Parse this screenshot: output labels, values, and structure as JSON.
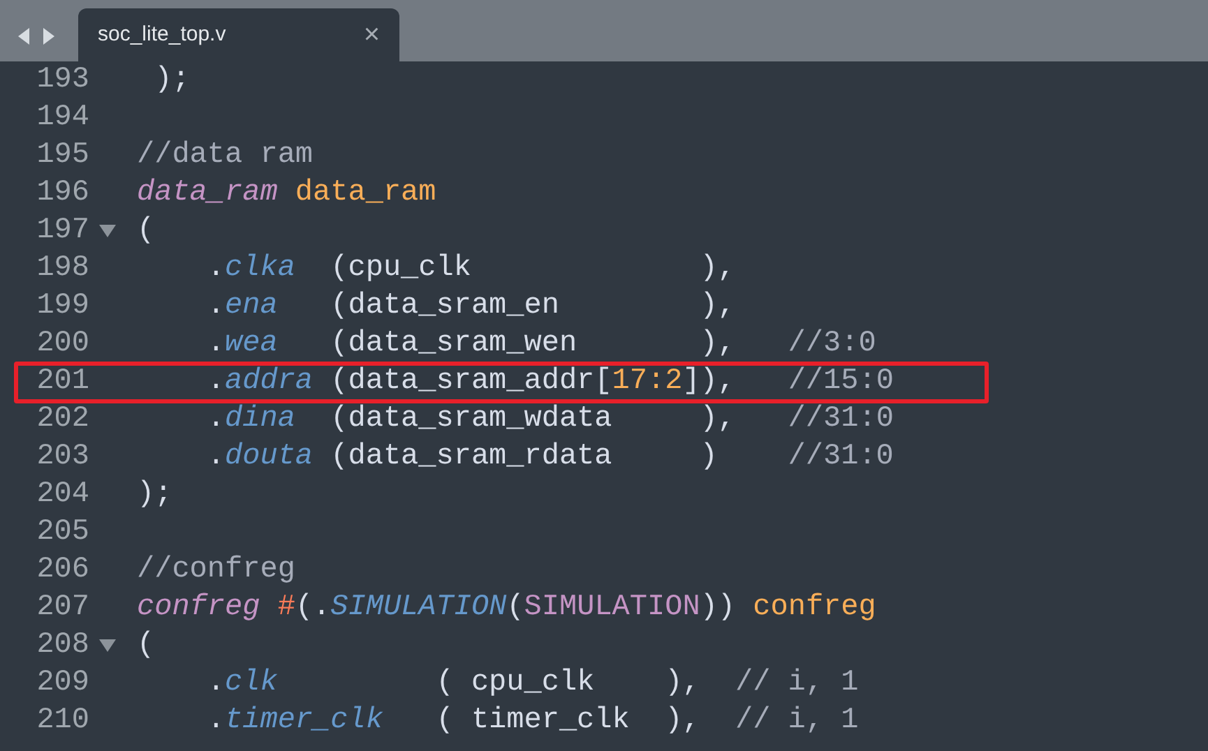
{
  "tab_bar": {
    "tabs": [
      {
        "label": "soc_lite_top.v",
        "close": "×",
        "selected": true
      }
    ]
  },
  "editor": {
    "lines": [
      {
        "number": "193",
        "foldable": false,
        "highlighted": false,
        "tokens": [
          {
            "kind": "plain",
            "text": " );"
          }
        ]
      },
      {
        "number": "194",
        "foldable": false,
        "highlighted": false
      },
      {
        "number": "195",
        "foldable": false,
        "highlighted": false,
        "tokens": [
          {
            "kind": "comment",
            "text": "//data ram"
          }
        ]
      },
      {
        "number": "196",
        "foldable": false,
        "highlighted": false,
        "tokens": [
          {
            "kind": "keyword",
            "text": "data_ram"
          },
          {
            "kind": "name",
            "text": " data_ram"
          }
        ]
      },
      {
        "number": "197",
        "foldable": true,
        "highlighted": false,
        "tokens": [
          {
            "kind": "plain",
            "text": "("
          }
        ]
      },
      {
        "number": "198",
        "foldable": false,
        "highlighted": false,
        "tokens": [
          {
            "kind": "plain",
            "text": "    ."
          },
          {
            "kind": "port",
            "text": "clka"
          },
          {
            "kind": "plain",
            "text": "  (cpu_clk             ),"
          }
        ]
      },
      {
        "number": "199",
        "foldable": false,
        "highlighted": false,
        "tokens": [
          {
            "kind": "plain",
            "text": "    ."
          },
          {
            "kind": "port",
            "text": "ena"
          },
          {
            "kind": "plain",
            "text": "   (data_sram_en        ),"
          }
        ]
      },
      {
        "number": "200",
        "foldable": false,
        "highlighted": false,
        "tokens": [
          {
            "kind": "plain",
            "text": "    ."
          },
          {
            "kind": "port",
            "text": "wea"
          },
          {
            "kind": "plain",
            "text": "   (data_sram_wen       ),"
          },
          {
            "kind": "comment",
            "text": "   //3:0"
          }
        ]
      },
      {
        "number": "201",
        "foldable": false,
        "highlighted": true,
        "tokens": [
          {
            "kind": "plain",
            "text": "    ."
          },
          {
            "kind": "port",
            "text": "addra"
          },
          {
            "kind": "plain",
            "text": " (data_sram_addr["
          },
          {
            "kind": "number",
            "text": "17:2"
          },
          {
            "kind": "plain",
            "text": "]),"
          },
          {
            "kind": "comment",
            "text": "   //15:0"
          }
        ]
      },
      {
        "number": "202",
        "foldable": false,
        "highlighted": false,
        "tokens": [
          {
            "kind": "plain",
            "text": "    ."
          },
          {
            "kind": "port",
            "text": "dina"
          },
          {
            "kind": "plain",
            "text": "  (data_sram_wdata     ),"
          },
          {
            "kind": "comment",
            "text": "   //31:0"
          }
        ]
      },
      {
        "number": "203",
        "foldable": false,
        "highlighted": false,
        "tokens": [
          {
            "kind": "plain",
            "text": "    ."
          },
          {
            "kind": "port",
            "text": "douta"
          },
          {
            "kind": "plain",
            "text": " (data_sram_rdata     )"
          },
          {
            "kind": "comment",
            "text": "    //31:0"
          }
        ]
      },
      {
        "number": "204",
        "foldable": false,
        "highlighted": false,
        "tokens": [
          {
            "kind": "plain",
            "text": ");"
          }
        ]
      },
      {
        "number": "205",
        "foldable": false,
        "highlighted": false
      },
      {
        "number": "206",
        "foldable": false,
        "highlighted": false,
        "tokens": [
          {
            "kind": "comment",
            "text": "//confreg"
          }
        ]
      },
      {
        "number": "207",
        "foldable": false,
        "highlighted": false,
        "tokens": [
          {
            "kind": "keyword",
            "text": "confreg"
          },
          {
            "kind": "operator",
            "text": " #"
          },
          {
            "kind": "plain",
            "text": "(."
          },
          {
            "kind": "port",
            "text": "SIMULATION"
          },
          {
            "kind": "plain",
            "text": "("
          },
          {
            "kind": "param",
            "text": "SIMULATION"
          },
          {
            "kind": "plain",
            "text": ")) "
          },
          {
            "kind": "name",
            "text": "confreg"
          }
        ]
      },
      {
        "number": "208",
        "foldable": true,
        "highlighted": false,
        "tokens": [
          {
            "kind": "plain",
            "text": "("
          }
        ]
      },
      {
        "number": "209",
        "foldable": false,
        "highlighted": false,
        "tokens": [
          {
            "kind": "plain",
            "text": "    ."
          },
          {
            "kind": "port",
            "text": "clk"
          },
          {
            "kind": "plain",
            "text": "         ( cpu_clk    ),"
          },
          {
            "kind": "comment",
            "text": "  // i, 1"
          }
        ]
      },
      {
        "number": "210",
        "foldable": false,
        "highlighted": false,
        "tokens": [
          {
            "kind": "plain",
            "text": "    ."
          },
          {
            "kind": "port",
            "text": "timer_clk"
          },
          {
            "kind": "plain",
            "text": "   ( timer_clk  ),"
          },
          {
            "kind": "comment",
            "text": "  // i, 1"
          }
        ]
      }
    ]
  }
}
